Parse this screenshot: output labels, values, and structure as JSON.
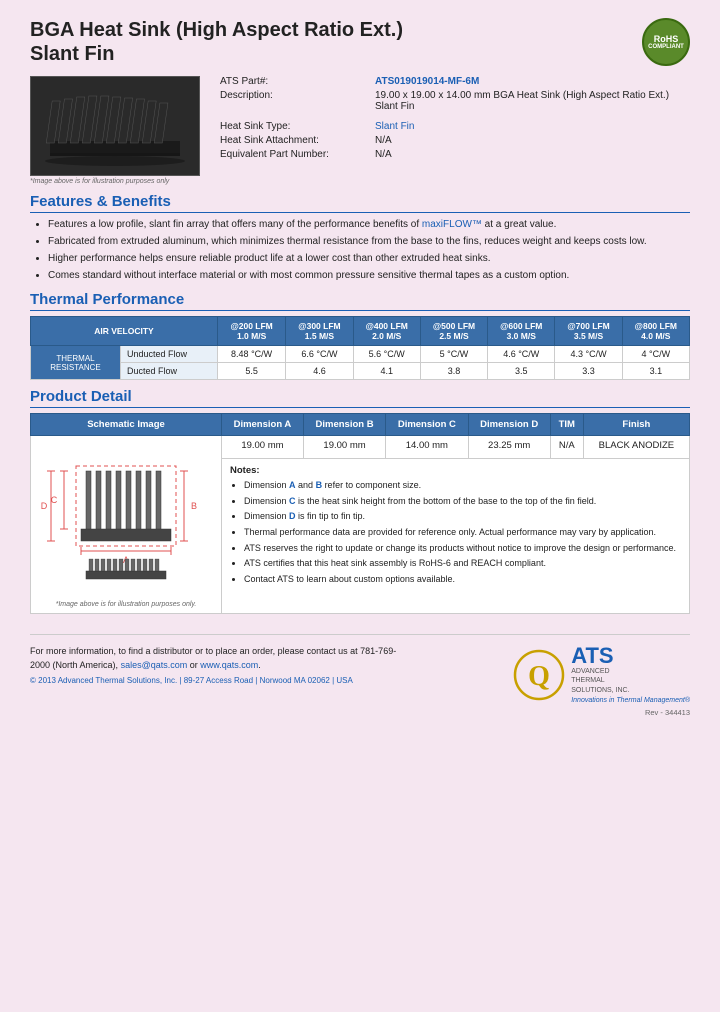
{
  "page": {
    "background_color": "#f5e6f0"
  },
  "header": {
    "title_line1": "BGA Heat Sink (High Aspect Ratio Ext.)",
    "title_line2": "Slant Fin",
    "rohs": {
      "line1": "RoHS",
      "line2": "COMPLIANT"
    }
  },
  "product_info": {
    "ats_part_label": "ATS Part#:",
    "ats_part_value": "ATS019019014-MF-6M",
    "description_label": "Description:",
    "description_value": "19.00 x 19.00 x 14.00 mm BGA Heat Sink (High Aspect Ratio Ext.) Slant Fin",
    "heat_sink_type_label": "Heat Sink Type:",
    "heat_sink_type_value": "Slant Fin",
    "heat_sink_attachment_label": "Heat Sink Attachment:",
    "heat_sink_attachment_value": "N/A",
    "equivalent_part_label": "Equivalent Part Number:",
    "equivalent_part_value": "N/A",
    "image_note": "*Image above is for illustration purposes only"
  },
  "features_benefits": {
    "heading": "Features & Benefits",
    "items": [
      "Features a low profile, slant fin array that offers many of the performance benefits of maxiFLOW™ at a great value.",
      "Fabricated from extruded aluminum, which minimizes thermal resistance from the base to the fins, reduces weight and keeps costs low.",
      "Higher performance helps ensure reliable product life at a lower cost than other extruded heat sinks.",
      "Comes standard without interface material or with most common pressure sensitive thermal tapes as a custom option."
    ],
    "maxiflow_link": "maxiFLOW™"
  },
  "thermal_performance": {
    "heading": "Thermal Performance",
    "table": {
      "col_header_label": "AIR VELOCITY",
      "columns": [
        {
          "lfm": "@200 LFM",
          "ms": "1.0 M/S"
        },
        {
          "lfm": "@300 LFM",
          "ms": "1.5 M/S"
        },
        {
          "lfm": "@400 LFM",
          "ms": "2.0 M/S"
        },
        {
          "lfm": "@500 LFM",
          "ms": "2.5 M/S"
        },
        {
          "lfm": "@600 LFM",
          "ms": "3.0 M/S"
        },
        {
          "lfm": "@700 LFM",
          "ms": "3.5 M/S"
        },
        {
          "lfm": "@800 LFM",
          "ms": "4.0 M/S"
        }
      ],
      "row_label": "THERMAL RESISTANCE",
      "rows": [
        {
          "label": "Unducted Flow",
          "values": [
            "8.48 °C/W",
            "6.6 °C/W",
            "5.6 °C/W",
            "5 °C/W",
            "4.6 °C/W",
            "4.3 °C/W",
            "4 °C/W"
          ]
        },
        {
          "label": "Ducted Flow",
          "values": [
            "5.5",
            "4.6",
            "4.1",
            "3.8",
            "3.5",
            "3.3",
            "3.1"
          ]
        }
      ]
    }
  },
  "product_detail": {
    "heading": "Product Detail",
    "table_headers": [
      "Schematic Image",
      "Dimension A",
      "Dimension B",
      "Dimension C",
      "Dimension D",
      "TIM",
      "Finish"
    ],
    "dimensions": {
      "a": "19.00 mm",
      "b": "19.00 mm",
      "c": "14.00 mm",
      "d": "23.25 mm",
      "tim": "N/A",
      "finish": "BLACK ANODIZE"
    },
    "notes_heading": "Notes:",
    "notes": [
      "Dimension A and B refer to component size.",
      "Dimension C is the heat sink height from the bottom of the base to the top of the fin field.",
      "Dimension D is fin tip to fin tip.",
      "Thermal performance data are provided for reference only. Actual performance may vary by application.",
      "ATS reserves the right to update or change its products without notice to improve the design or performance.",
      "ATS certifies that this heat sink assembly is RoHS-6 and REACH compliant.",
      "Contact ATS to learn about custom options available."
    ],
    "schematic_note": "*Image above is for illustration purposes only."
  },
  "footer": {
    "contact_text": "For more information, to find a distributor or to place an order, please contact us at 781-769-2000 (North America),",
    "email": "sales@qats.com",
    "email_connector": "or",
    "website": "www.qats.com",
    "copyright": "© 2013 Advanced Thermal Solutions, Inc. | 89-27 Access Road | Norwood MA  02062 | USA",
    "ats_logo": {
      "q_symbol": "Q",
      "ats_text": "ATS",
      "company_name_line1": "ADVANCED",
      "company_name_line2": "THERMAL",
      "company_name_line3": "SOLUTIONS, INC.",
      "tagline": "Innovations in Thermal Management®"
    },
    "rev": "Rev - 344413"
  }
}
